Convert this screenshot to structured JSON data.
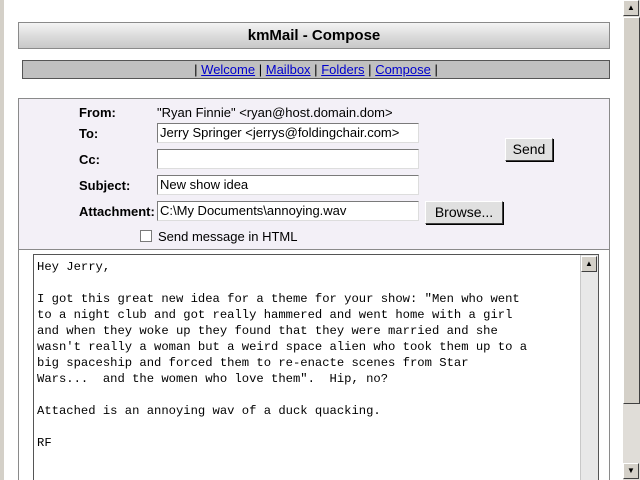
{
  "title": "kmMail - Compose",
  "nav": {
    "sep": "|",
    "items": [
      "Welcome",
      "Mailbox",
      "Folders",
      "Compose"
    ]
  },
  "form": {
    "from_label": "From:",
    "from_value": "\"Ryan Finnie\" <ryan@host.domain.dom>",
    "to_label": "To:",
    "to_value": "Jerry Springer <jerrys@foldingchair.com>",
    "cc_label": "Cc:",
    "cc_value": "",
    "subject_label": "Subject:",
    "subject_value": "New show idea",
    "attachment_label": "Attachment:",
    "attachment_value": "C:\\My Documents\\annoying.wav",
    "browse_label": "Browse...",
    "send_label": "Send",
    "html_label": "Send message in HTML",
    "html_checked": false
  },
  "message": {
    "body": "Hey Jerry,\n\nI got this great new idea for a theme for your show: \"Men who went\nto a night club and got really hammered and went home with a girl\nand when they woke up they found that they were married and she\nwasn't really a woman but a weird space alien who took them up to a\nbig spaceship and forced them to re-enacte scenes from Star\nWars...  and the women who love them\".  Hip, no?\n\nAttached is an annoying wav of a duck quacking.\n\nRF"
  }
}
